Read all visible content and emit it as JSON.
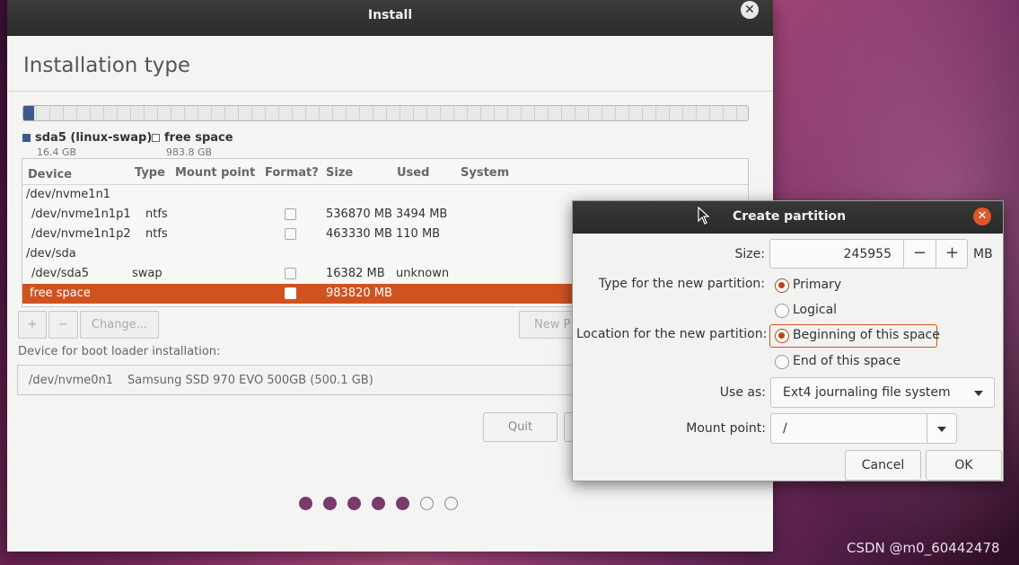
{
  "install_window": {
    "title": "Install",
    "close_glyph": "✕",
    "heading": "Installation type",
    "legend": [
      {
        "name": "sda5 (linux-swap)",
        "size": "16.4 GB",
        "color": "#3d5a8f"
      },
      {
        "name": "free space",
        "size": "983.8 GB",
        "color": "#ffffff"
      }
    ],
    "table": {
      "headers": {
        "device": "Device",
        "type": "Type",
        "mount": "Mount point",
        "format": "Format?",
        "size": "Size",
        "used": "Used",
        "system": "System"
      },
      "rows": [
        {
          "device": "/dev/nvme1n1",
          "type": "",
          "size": "",
          "used": "",
          "group": true
        },
        {
          "device": "/dev/nvme1n1p1",
          "type": "ntfs",
          "size": "536870 MB",
          "used": "3494 MB"
        },
        {
          "device": "/dev/nvme1n1p2",
          "type": "ntfs",
          "size": "463330 MB",
          "used": "110 MB"
        },
        {
          "device": "/dev/sda",
          "type": "",
          "size": "",
          "used": "",
          "group": true
        },
        {
          "device": "/dev/sda5",
          "type": "swap",
          "size": "16382 MB",
          "used": "unknown"
        },
        {
          "device": "free space",
          "type": "",
          "size": "983820 MB",
          "used": "",
          "selected": true
        }
      ]
    },
    "toolbar": {
      "add": "+",
      "remove": "−",
      "change": "Change...",
      "new_partition": "New P"
    },
    "boot_loader": {
      "label": "Device for boot loader installation:",
      "device": "/dev/nvme0n1",
      "description": "Samsung SSD 970 EVO 500GB (500.1 GB)"
    },
    "buttons": {
      "quit": "Quit"
    },
    "progress": {
      "total_steps": 7,
      "completed_steps": 5
    }
  },
  "dialog": {
    "title": "Create partition",
    "close_glyph": "✕",
    "size_label": "Size:",
    "size_value": "245955",
    "size_decrement": "−",
    "size_increment": "+",
    "size_unit": "MB",
    "type_label": "Type for the new partition:",
    "type_options": [
      "Primary",
      "Logical"
    ],
    "type_selected": "Primary",
    "location_label": "Location for the new partition:",
    "location_options": [
      "Beginning of this space",
      "End of this space"
    ],
    "location_selected": "Beginning of this space",
    "use_as_label": "Use as:",
    "use_as_value": "Ext4 journaling file system",
    "mount_label": "Mount point:",
    "mount_value": "/",
    "cancel": "Cancel",
    "ok": "OK"
  },
  "watermark": "CSDN @m0_60442478",
  "colors": {
    "accent": "#d0531f",
    "progress_dot": "#7a3a6a",
    "swap": "#3d5a8f"
  }
}
